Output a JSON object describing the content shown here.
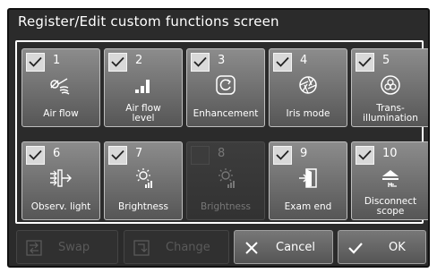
{
  "screen": {
    "title": "Register/Edit custom functions screen"
  },
  "tiles": [
    {
      "number": "1",
      "label": "Air flow",
      "icon": "air-flow-icon",
      "checked": true,
      "enabled": true
    },
    {
      "number": "2",
      "label": "Air flow\nlevel",
      "icon": "signal-bars-icon",
      "checked": true,
      "enabled": true
    },
    {
      "number": "3",
      "label": "Enhancement",
      "icon": "enhancement-icon",
      "checked": true,
      "enabled": true
    },
    {
      "number": "4",
      "label": "Iris mode",
      "icon": "aperture-icon",
      "checked": true,
      "enabled": true
    },
    {
      "number": "5",
      "label": "Trans-\nillumination",
      "icon": "transillumination-icon",
      "checked": true,
      "enabled": true
    },
    {
      "number": "6",
      "label": "Observ. light",
      "icon": "observation-light-icon",
      "checked": true,
      "enabled": true
    },
    {
      "number": "7",
      "label": "Brightness",
      "icon": "brightness-icon",
      "checked": true,
      "enabled": true
    },
    {
      "number": "8",
      "label": "Brightness",
      "icon": "brightness-icon",
      "checked": false,
      "enabled": false
    },
    {
      "number": "9",
      "label": "Exam end",
      "icon": "exam-end-icon",
      "checked": true,
      "enabled": true
    },
    {
      "number": "10",
      "label": "Disconnect\nscope",
      "icon": "disconnect-scope-icon",
      "checked": true,
      "enabled": true
    }
  ],
  "buttons": {
    "swap": {
      "label": "Swap",
      "enabled": false,
      "icon": "swap-icon"
    },
    "change": {
      "label": "Change",
      "enabled": false,
      "icon": "change-icon"
    },
    "cancel": {
      "label": "Cancel",
      "enabled": true,
      "icon": "close-icon"
    },
    "ok": {
      "label": "OK",
      "enabled": true,
      "icon": "checkmark-icon"
    }
  },
  "colors": {
    "screen_bg": "#2b2b2b",
    "tile_top": "#8c8c8c",
    "tile_bottom": "#565656",
    "checkbox": "#d9d9d9",
    "frame": "#ffffff"
  }
}
